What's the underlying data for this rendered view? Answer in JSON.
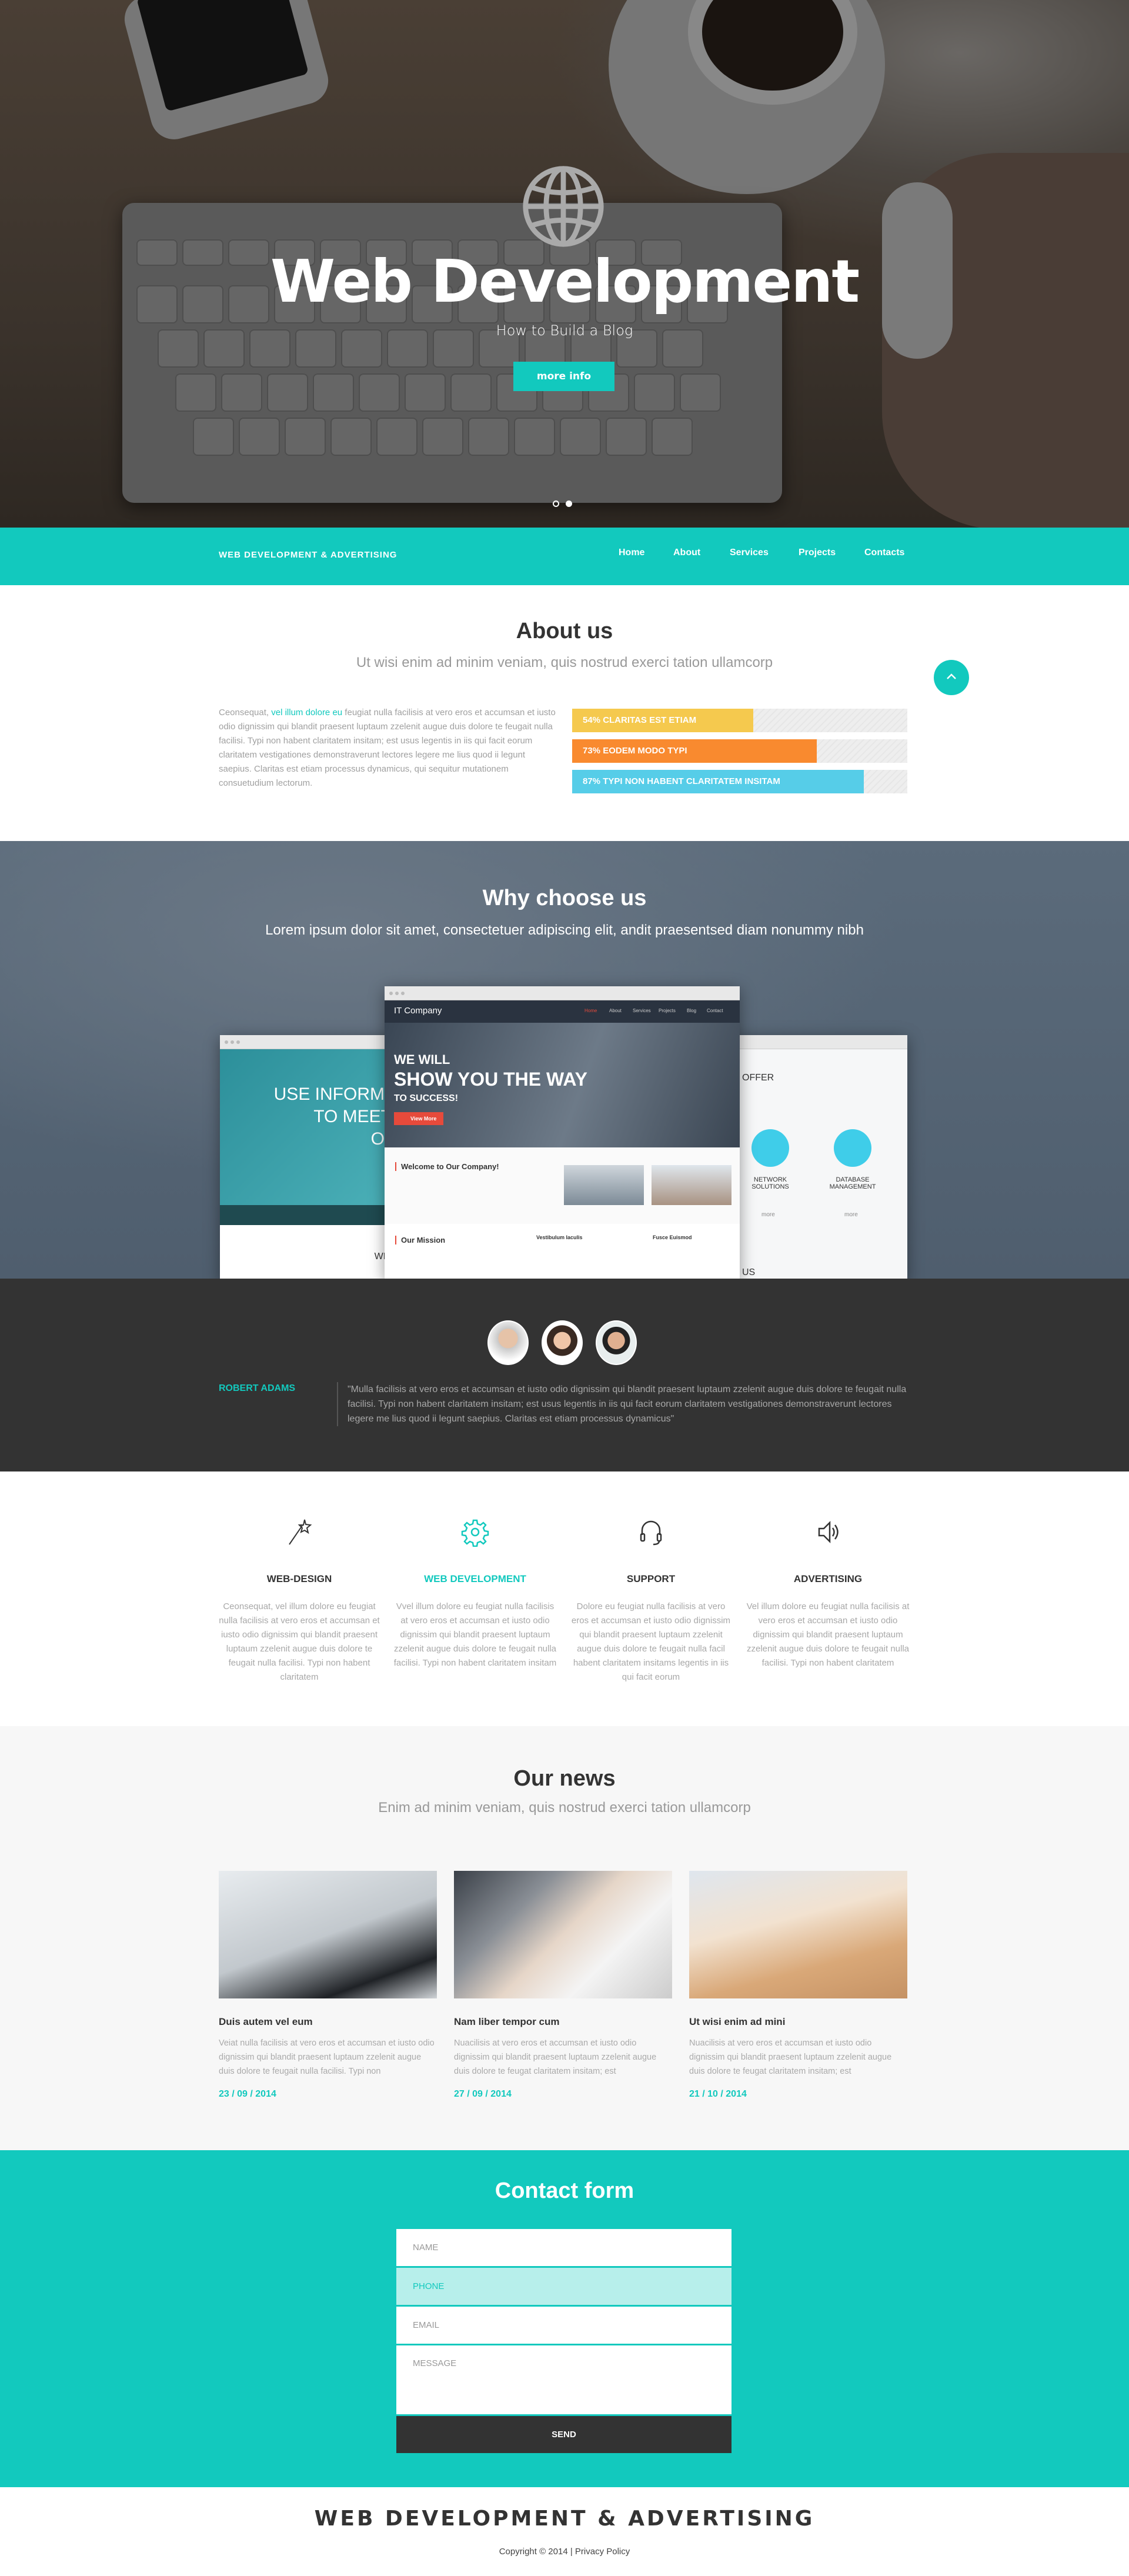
{
  "hero": {
    "title": "Web Development",
    "subtitle": "How to Build a Blog",
    "button": "more info",
    "slides": 2,
    "active_slide": 2,
    "icon": "globe-icon"
  },
  "nav": {
    "brand": "WEB DEVELOPMENT & ADVERTISING",
    "links": [
      "Home",
      "About",
      "Services",
      "Projects",
      "Contacts"
    ]
  },
  "about": {
    "title": "About us",
    "subtitle": "Ut wisi enim ad minim veniam, quis nostrud exerci tation ullamcorp",
    "text_before": "Ceonsequat, ",
    "text_link": "vel illum dolore eu",
    "text_after": " feugiat nulla facilisis at vero eros et accumsan et iusto odio dignissim qui blandit praesent luptaum zzelenit augue duis dolore te feugait nulla facilisi. Typi non habent claritatem insitam; est usus legentis in iis qui facit eorum claritatem vestigationes demonstraverunt lectores legere me lius quod ii legunt saepius. Claritas est etiam processus dynamicus, qui sequitur mutationem consuetudium lectorum.",
    "bars": [
      {
        "label": "54%  CLARITAS EST ETIAM",
        "percent": 54,
        "color": "#f5c94e"
      },
      {
        "label": "73%  EODEM MODO TYPI",
        "percent": 73,
        "color": "#f98a2f"
      },
      {
        "label": "87%  TYPI NON HABENT CLARITATEM INSITAM",
        "percent": 87,
        "color": "#56cde8"
      }
    ]
  },
  "why": {
    "title": "Why choose us",
    "subtitle": "Lorem ipsum dolor sit amet, consectetuer adipiscing elit, andit praesentsed diam nonummy nibh",
    "mock_center": {
      "logo": "IT Company",
      "nav": [
        "Home",
        "About",
        "Services",
        "Projects",
        "Blog",
        "Contact"
      ],
      "line1": "WE WILL",
      "line2": "SHOW YOU THE WAY",
      "line3": "TO SUCCESS!",
      "button": "View More",
      "welcome": "Welcome to Our Company!",
      "mission": "Our Mission",
      "feat1": "Vestibulum Iaculis",
      "feat2": "Fusce Euismod"
    },
    "mock_left": {
      "line1": "USE INFORMA",
      "line2": "TO MEET",
      "line3": "OB",
      "footer": "WHA"
    },
    "mock_right": {
      "heading": "OFFER",
      "item1": "NETWORK SOLUTIONS",
      "item2": "DATABASE MANAGEMENT",
      "more": "more",
      "footer": "US"
    }
  },
  "testimonial": {
    "name": "ROBERT ADAMS",
    "quote": "\"Mulla facilisis at vero eros et accumsan et iusto odio dignissim qui blandit praesent luptaum zzelenit augue duis dolore te feugait nulla facilisi. Typi non habent claritatem insitam; est usus legentis in iis qui facit eorum claritatem vestigationes demonstraverunt lectores legere me lius quod ii legunt saepius. Claritas est etiam processus dynamicus\""
  },
  "services": [
    {
      "icon": "magic-wand-icon",
      "title": "WEB-DESIGN",
      "text": "Ceonsequat, vel illum dolore eu feugiat nulla facilisis at vero eros et accumsan et iusto odio dignissim qui blandit praesent luptaum zzelenit augue duis dolore te feugait nulla facilisi. Typi non habent claritatem"
    },
    {
      "icon": "gear-icon",
      "title": "WEB DEVELOPMENT",
      "text": "Vvel illum dolore eu feugiat nulla facilisis at vero eros et accumsan et iusto odio dignissim qui blandit praesent luptaum zzelenit augue duis dolore te feugait nulla facilisi. Typi non habent claritatem insitam",
      "active": true
    },
    {
      "icon": "headset-icon",
      "title": "SUPPORT",
      "text": "Dolore eu feugiat nulla facilisis at vero eros et accumsan et iusto odio dignissim qui blandit praesent luptaum zzelenit augue duis dolore te feugait nulla facil habent claritatem insitams legentis in iis qui facit eorum"
    },
    {
      "icon": "speaker-icon",
      "title": "ADVERTISING",
      "text": "Vel illum dolore eu feugiat nulla facilisis at vero eros et accumsan et iusto odio dignissim qui blandit praesent luptaum zzelenit augue duis dolore te feugait nulla facilisi. Typi non habent claritatem"
    }
  ],
  "news": {
    "title": "Our news",
    "subtitle": "Enim ad minim veniam, quis nostrud exerci tation ullamcorp",
    "items": [
      {
        "title": "Duis autem vel eum",
        "text": "Veiat nulla facilisis at vero eros et accumsan et iusto odio dignissim qui blandit praesent luptaum zzelenit augue duis dolore te feugait nulla facilisi. Typi non",
        "date": "23 / 09 / 2014"
      },
      {
        "title": "Nam liber tempor cum",
        "text": "Nuacilisis at vero eros et accumsan et iusto odio dignissim qui blandit praesent luptaum zzelenit augue duis dolore te feugat claritatem insitam; est",
        "date": "27 / 09 / 2014"
      },
      {
        "title": "Ut wisi enim ad mini",
        "text": "Nuacilisis at vero eros et accumsan et iusto odio dignissim qui blandit praesent luptaum zzelenit augue duis dolore te feugat claritatem insitam; est",
        "date": "21 / 10 / 2014"
      }
    ]
  },
  "contact": {
    "title": "Contact form",
    "name_placeholder": "NAME",
    "phone_placeholder": "PHONE",
    "email_placeholder": "EMAIL",
    "message_placeholder": "MESSAGE",
    "send": "SEND"
  },
  "footer": {
    "brand": "WEB DEVELOPMENT & ADVERTISING",
    "copyright": "Copyright © 2014 | ",
    "privacy": "Privacy Policy"
  },
  "colors": {
    "accent": "#12c9be",
    "dark": "#333333"
  }
}
